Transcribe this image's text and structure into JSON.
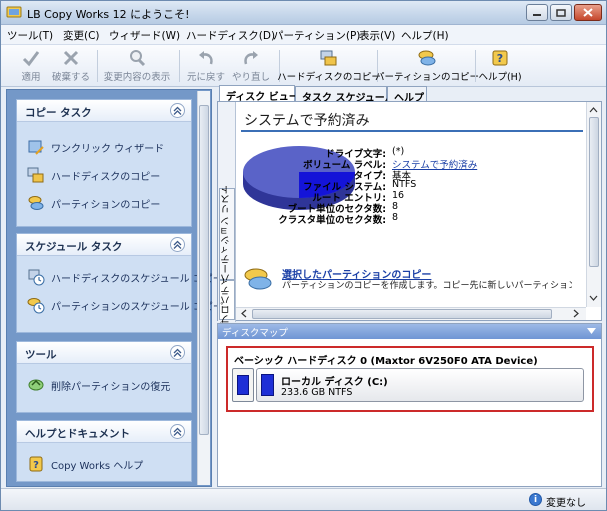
{
  "window": {
    "title": "LB Copy Works 12 にようこそ!"
  },
  "menu": [
    "ツール(T)",
    "変更(C)",
    "ウィザード(W)",
    "ハードディスク(D)",
    "パーティション(P)",
    "表示(V)",
    "ヘルプ(H)"
  ],
  "toolbar": {
    "apply": "適用",
    "discard": "破棄する",
    "view_changes": "変更内容の表示",
    "undo": "元に戻す",
    "redo": "やり直し",
    "disk_copy": "ハードディスクのコピー",
    "partition_copy": "パーティションのコピー",
    "help": "ヘルプ(H)"
  },
  "sidebar": {
    "copy_tasks": {
      "title": "コピー タスク",
      "items": [
        "ワンクリック ウィザード",
        "ハードディスクのコピー",
        "パーティションのコピー"
      ]
    },
    "schedule_tasks": {
      "title": "スケジュール タスク",
      "items": [
        "ハードディスクのスケジュール コピー",
        "パーティションのスケジュール コピー"
      ]
    },
    "tools": {
      "title": "ツール",
      "items": [
        "削除パーティションの復元"
      ]
    },
    "help_docs": {
      "title": "ヘルプとドキュメント",
      "items": [
        "Copy Works ヘルプ"
      ]
    }
  },
  "tabs": [
    "ディスク ビュー",
    "タスク スケジュール",
    "ヘルプ"
  ],
  "vtabs": [
    "パーティション リスト",
    "プロパティ"
  ],
  "volume": {
    "title": "システムで予約済み",
    "properties": [
      {
        "label": "ドライブ文字:",
        "value": "(*)"
      },
      {
        "label": "ボリューム ラベル:",
        "value": "システムで予約済み"
      },
      {
        "label": "タイプ:",
        "value": "基本"
      },
      {
        "label": "ファイル システム:",
        "value": "NTFS"
      },
      {
        "label": "ルート エントリ:",
        "value": "16"
      },
      {
        "label": "ブート単位のセクタ数:",
        "value": "8"
      },
      {
        "label": "クラスタ単位のセクタ数:",
        "value": "8"
      }
    ],
    "used_fraction": 0.25,
    "colors": {
      "free": "#5a63c8",
      "used": "#1414d8"
    }
  },
  "action": {
    "title": "選択したパーティションのコピー",
    "desc": "パーティションのコピーを作成します。コピー先に新しいパーティションが作成さ"
  },
  "diskmap": {
    "header": "ディスクマップ",
    "disk_title": "ベーシック ハードディスク 0 (Maxtor 6V250F0 ATA Device)",
    "partition_name": "ローカル ディスク (C:)",
    "partition_info": "233.6 GB NTFS"
  },
  "status": {
    "text": "変更なし"
  }
}
